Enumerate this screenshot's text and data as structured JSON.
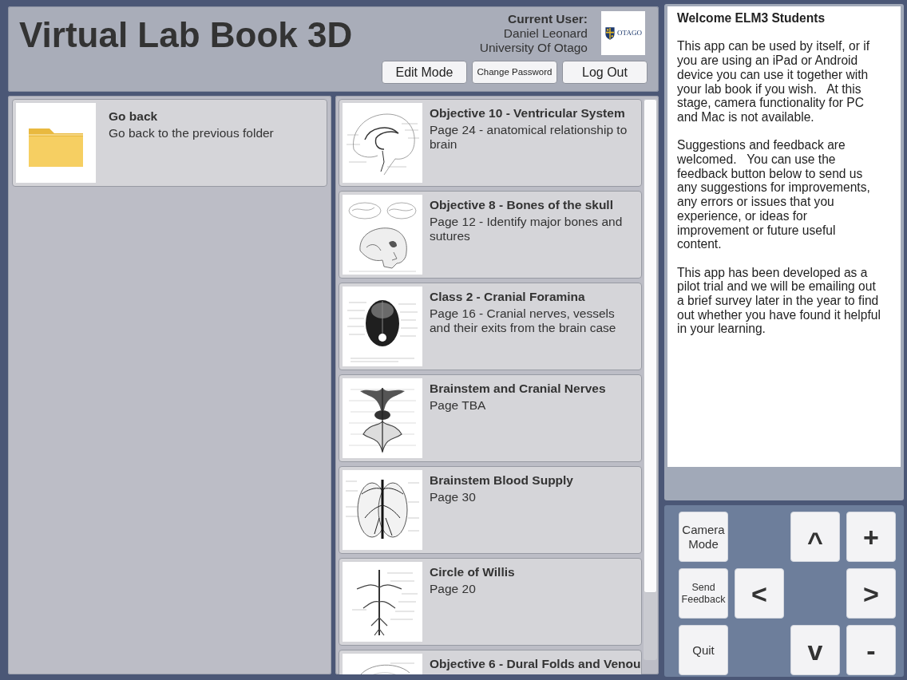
{
  "header": {
    "title": "Virtual Lab Book 3D",
    "user_label": "Current User:",
    "user_name": "Daniel Leonard",
    "institution": "University Of Otago",
    "logo_text": "OTAGO",
    "buttons": [
      "Edit Mode",
      "Change Password",
      "Log Out"
    ]
  },
  "folders": [
    {
      "title": "Go back",
      "subtitle": "Go back to the previous folder"
    }
  ],
  "pages": [
    {
      "title": "Objective 10 - Ventricular System",
      "subtitle": "Page 24 - anatomical relationship to brain",
      "kind": "ventricles"
    },
    {
      "title": "Objective 8 - Bones of the skull",
      "subtitle": "Page 12 - Identify major bones and sutures",
      "kind": "skull"
    },
    {
      "title": "Class 2 - Cranial Foramina",
      "subtitle": "Page 16 - Cranial nerves, vessels and their exits from the brain case",
      "kind": "foramina"
    },
    {
      "title": "Brainstem and Cranial Nerves",
      "subtitle": "Page TBA",
      "kind": "brainstem"
    },
    {
      "title": "Brainstem Blood Supply",
      "subtitle": "Page 30",
      "kind": "underside"
    },
    {
      "title": "Circle of Willis",
      "subtitle": "Page 20",
      "kind": "arteries"
    },
    {
      "title": "Objective 6 - Dural Folds and Venou",
      "kind": "outline"
    }
  ],
  "welcome": {
    "heading": "Welcome ELM3 Students",
    "paragraphs": [
      "This app can be used by itself, or if you are using an iPad or Android device you can use it together with your lab book if you wish.   At this stage, camera functionality for PC and Mac is not available.",
      "Suggestions and feedback are welcomed.   You can use the feedback button below to send us any suggestions for improvements, any errors or issues that you experience, or ideas for improvement or future useful content.",
      "This app has been developed as a pilot trial and we will be emailing out a brief survey later in the year to find out whether you have found it helpful in your learning."
    ]
  },
  "side_buttons": [
    "Camera Mode",
    "Send Feedback",
    "Quit"
  ],
  "direction_pad": {
    "up": "^",
    "plus": "+",
    "left": "<",
    "right": ">",
    "down": "v",
    "minus": "-"
  }
}
